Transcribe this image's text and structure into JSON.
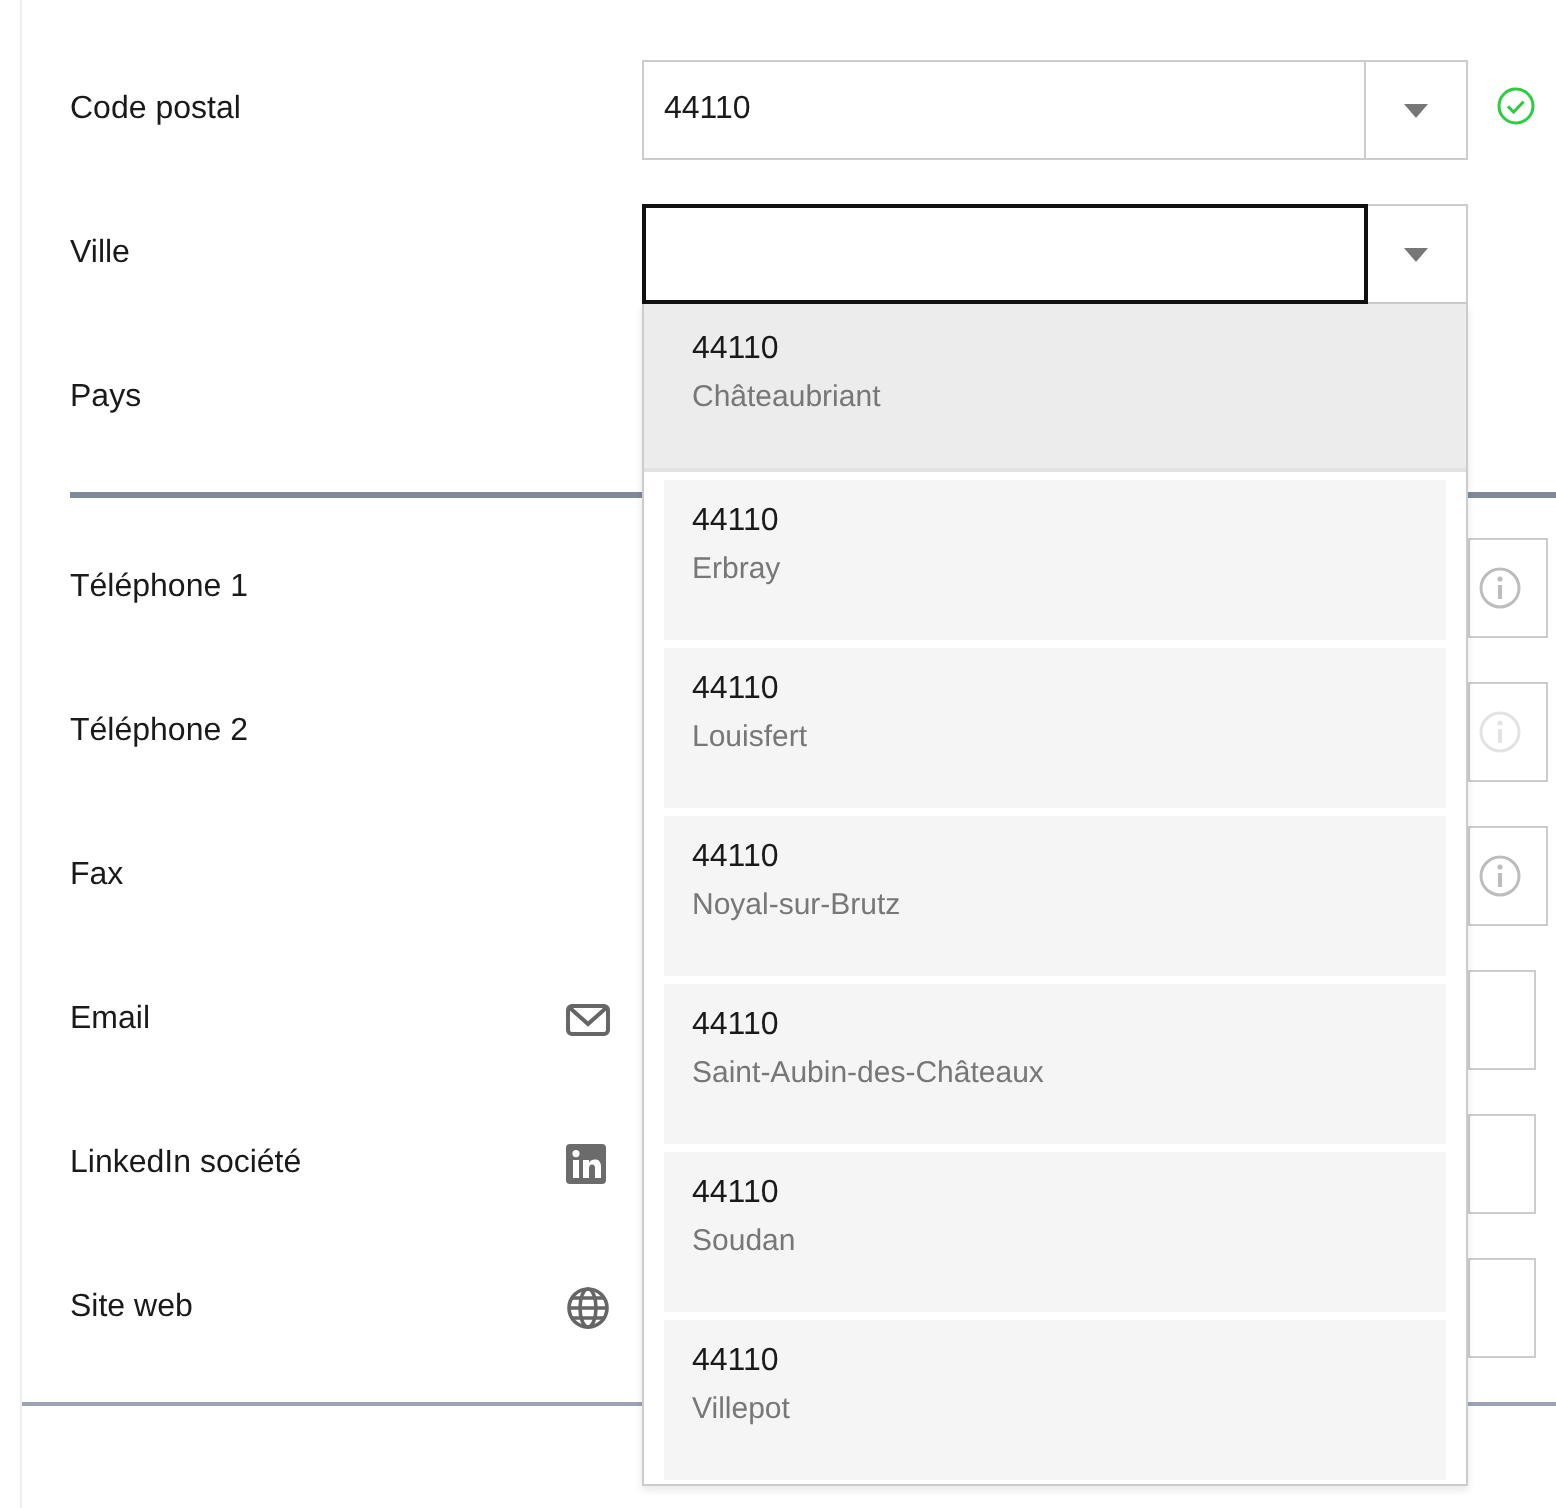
{
  "address_fields": [
    {
      "label": "Code postal",
      "kind": "combo",
      "value": "44110",
      "focused": false,
      "valid": true
    },
    {
      "label": "Ville",
      "kind": "combo",
      "focused": true
    },
    {
      "label": "Pays",
      "kind": "hidden"
    }
  ],
  "contact_rows": [
    {
      "label": "Téléphone 1",
      "kind": "phone",
      "disabled": false
    },
    {
      "label": "Téléphone 2",
      "kind": "phone",
      "disabled": true
    },
    {
      "label": "Fax",
      "kind": "phone",
      "disabled": false
    },
    {
      "label": "Email",
      "kind": "email"
    },
    {
      "label": "LinkedIn société",
      "kind": "linkedin"
    },
    {
      "label": "Site web",
      "kind": "web"
    }
  ],
  "suggestions": [
    {
      "code": "44110",
      "city": "Châteaubriant",
      "selected": true
    },
    {
      "code": "44110",
      "city": "Erbray",
      "selected": false
    },
    {
      "code": "44110",
      "city": "Louisfert",
      "selected": false
    },
    {
      "code": "44110",
      "city": "Noyal-sur-Brutz",
      "selected": false
    },
    {
      "code": "44110",
      "city": "Saint-Aubin-des-Châteaux",
      "selected": false
    },
    {
      "code": "44110",
      "city": "Soudan",
      "selected": false
    },
    {
      "code": "44110",
      "city": "Villepot",
      "selected": false
    }
  ]
}
